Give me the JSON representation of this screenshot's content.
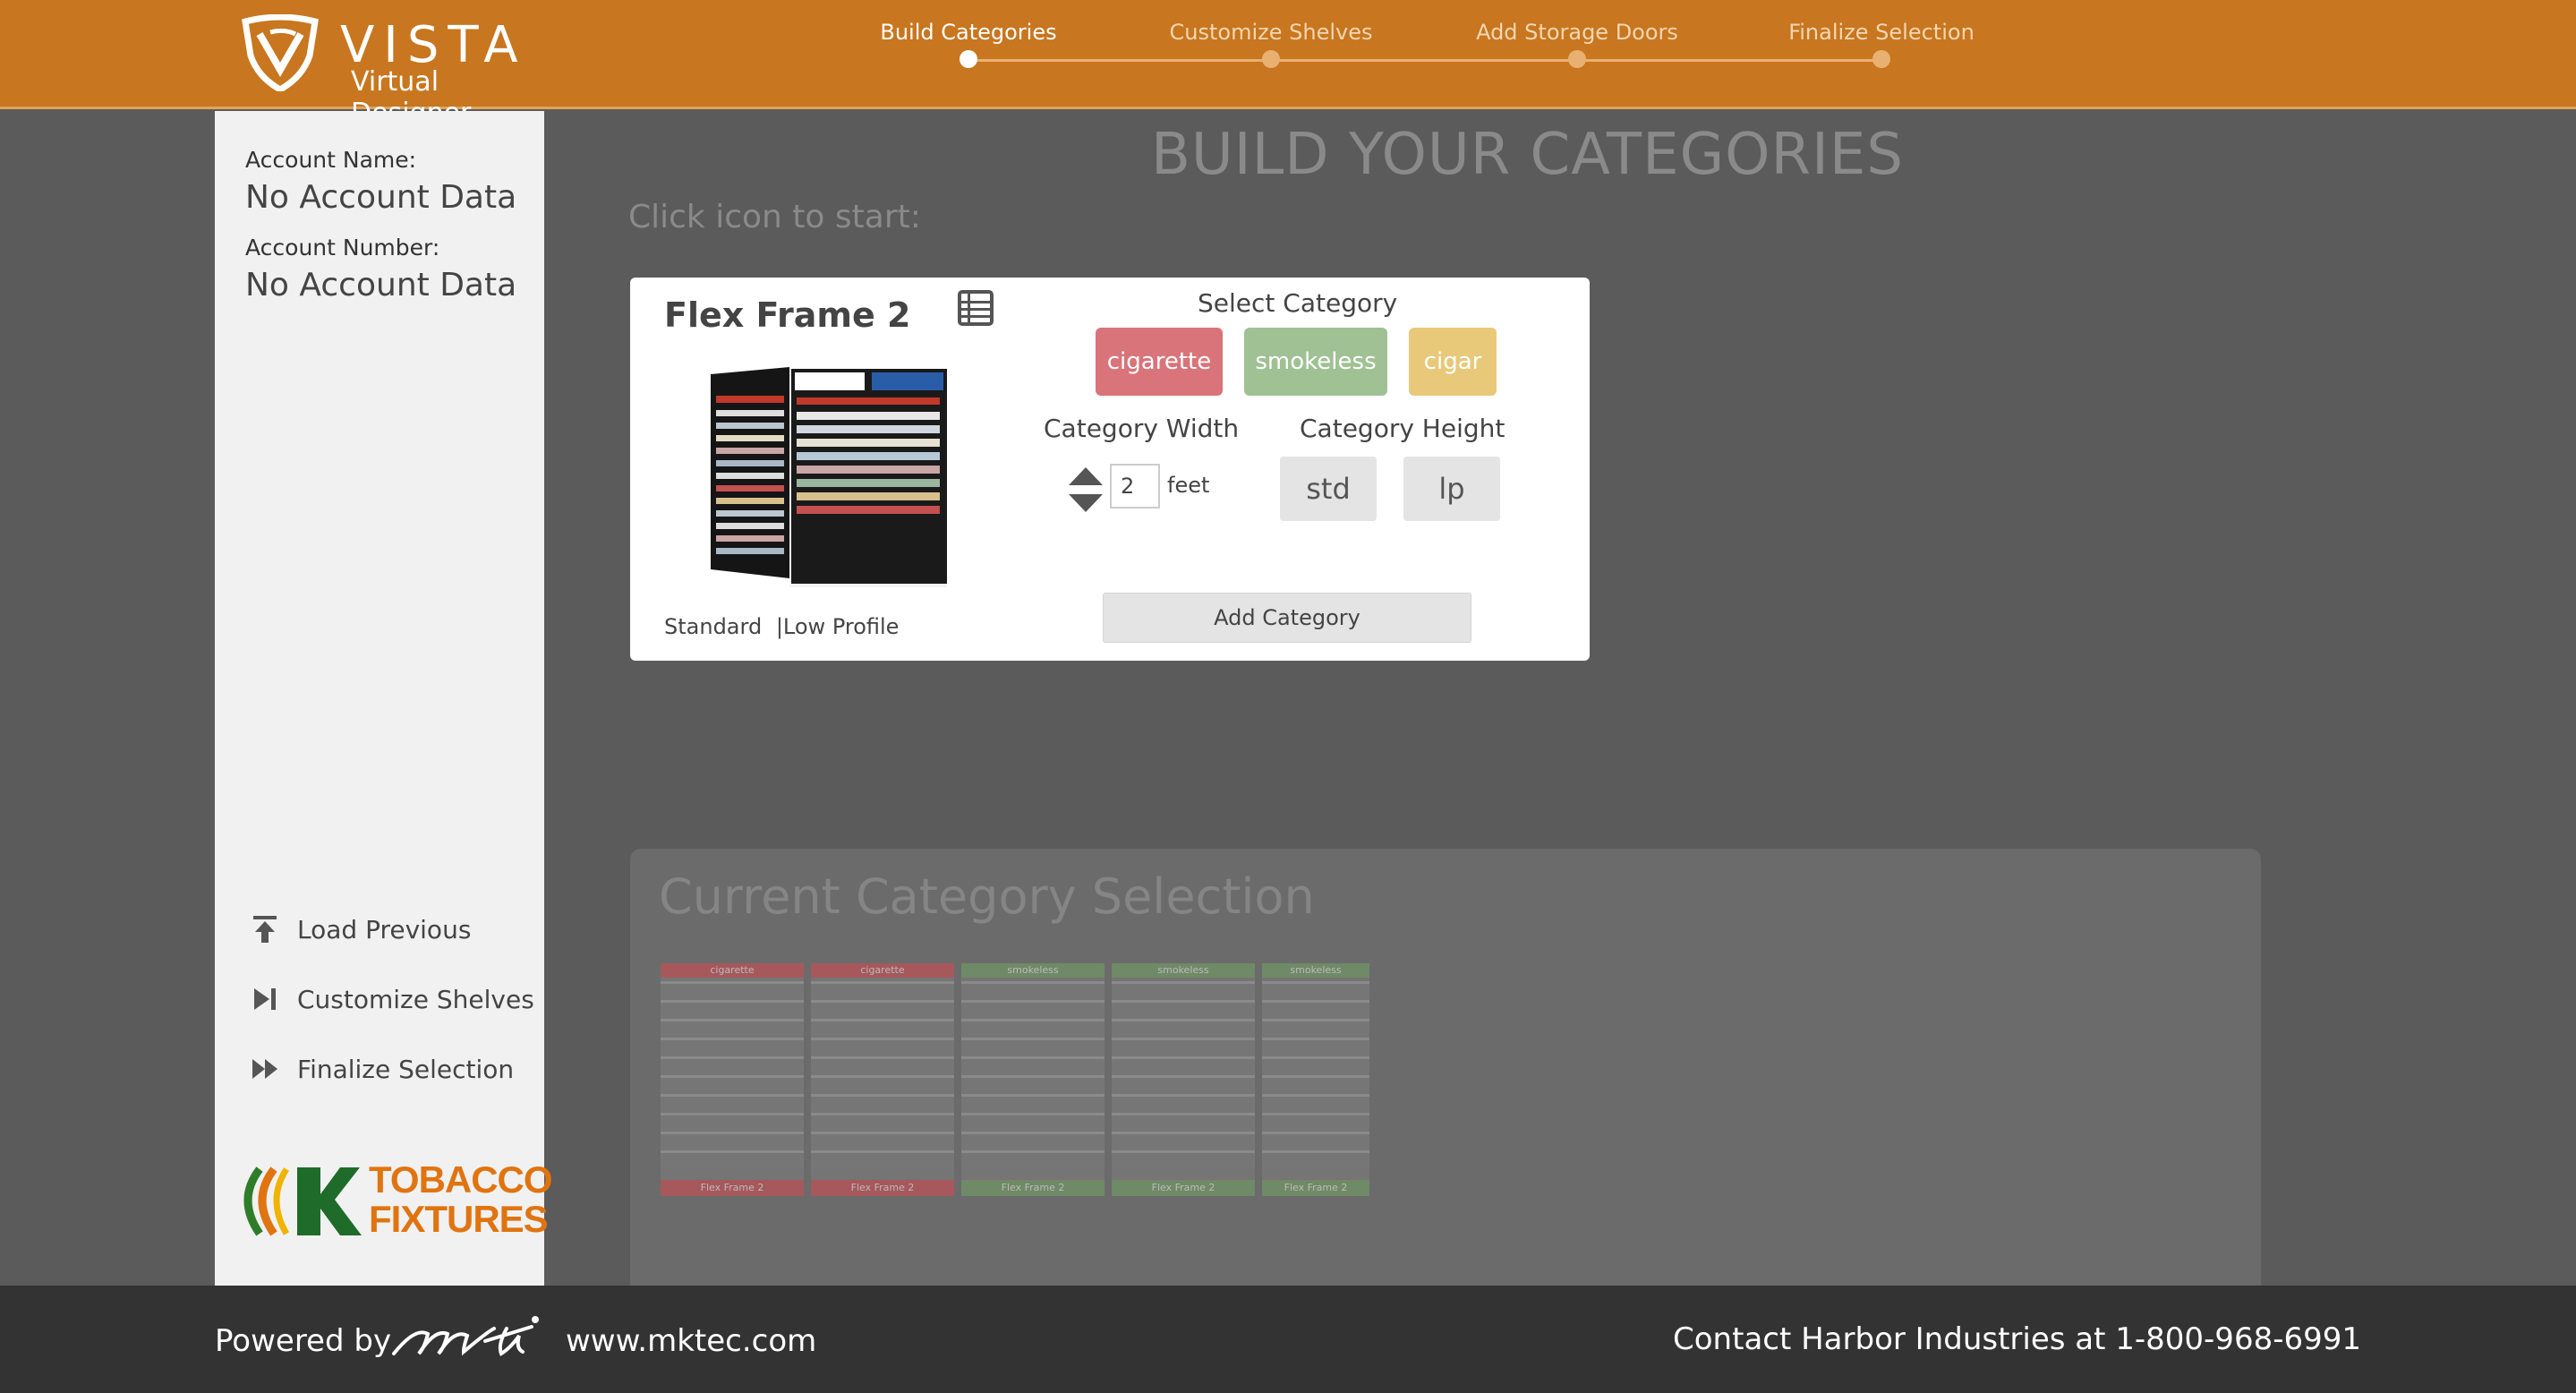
{
  "header": {
    "logo_title": "VISTA",
    "logo_subtitle": "Virtual Designer",
    "steps": [
      {
        "label": "Build Categories",
        "active": true
      },
      {
        "label": "Customize Shelves",
        "active": false
      },
      {
        "label": "Add Storage Doors",
        "active": false
      },
      {
        "label": "Finalize Selection",
        "active": false
      }
    ],
    "brand_color": "#c8761f"
  },
  "sidebar": {
    "account_name_label": "Account Name:",
    "account_name_value": "No Account Data",
    "account_number_label": "Account Number:",
    "account_number_value": "No Account Data",
    "actions": [
      {
        "label": "Load Previous",
        "icon": "upload-icon"
      },
      {
        "label": "Customize Shelves",
        "icon": "play-skip-icon"
      },
      {
        "label": "Finalize Selection",
        "icon": "fast-forward-icon"
      }
    ],
    "partner_logo_line1": "TOBACCO",
    "partner_logo_line2": "FIXTURES"
  },
  "main": {
    "title": "BUILD YOUR CATEGORIES",
    "instruction": "Click icon to start:"
  },
  "card": {
    "product_name": "Flex Frame 2",
    "profile_standard": "Standard",
    "profile_separator": "|",
    "profile_low": "Low Profile",
    "select_category_label": "Select Category",
    "categories": [
      {
        "label": "cigarette",
        "color": "#d9747a"
      },
      {
        "label": "smokeless",
        "color": "#9fc193"
      },
      {
        "label": "cigar",
        "color": "#e8c97a"
      }
    ],
    "width_label": "Category Width",
    "width_value": "2",
    "width_unit": "feet",
    "height_label": "Category Height",
    "height_options": [
      "std",
      "lp"
    ],
    "add_button": "Add Category"
  },
  "current": {
    "title": "Current Category Selection",
    "modules": [
      {
        "category": "cigarette",
        "frame": "Flex Frame 2"
      },
      {
        "category": "cigarette",
        "frame": "Flex Frame 2"
      },
      {
        "category": "smokeless",
        "frame": "Flex Frame 2"
      },
      {
        "category": "smokeless",
        "frame": "Flex Frame 2"
      },
      {
        "category": "smokeless",
        "frame": "Flex Frame 2"
      }
    ]
  },
  "footer": {
    "powered_by": "Powered by",
    "brand": "mti",
    "website": "www.mktec.com",
    "contact": "Contact Harbor Industries at 1-800-968-6991"
  }
}
